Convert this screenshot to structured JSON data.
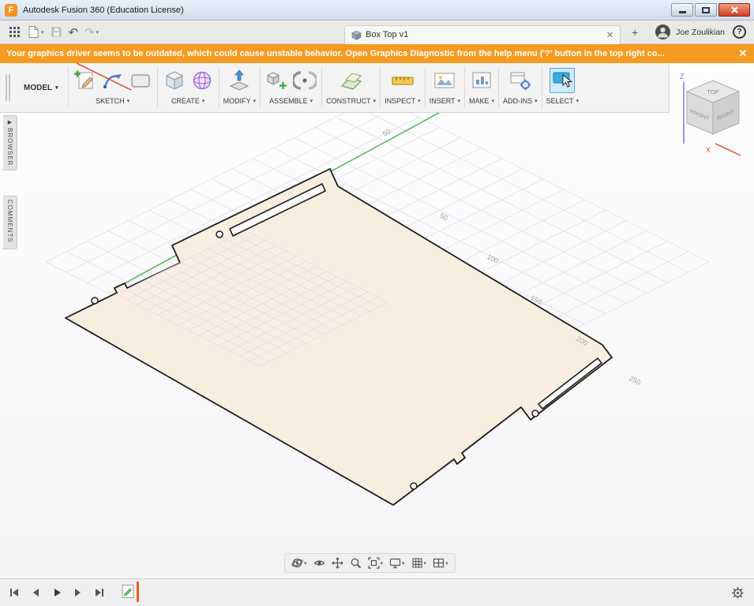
{
  "window": {
    "logo_letter": "F",
    "title": "Autodesk Fusion 360 (Education License)"
  },
  "tabrow": {
    "undo_glyph": "↶",
    "redo_glyph": "↷",
    "tab_label": "Box Top v1",
    "tab_close": "✕",
    "new_tab": "+",
    "user_name": "Joe Zoulikian",
    "help": "?"
  },
  "banner": {
    "text": "Your graphics driver seems to be outdated, which could cause unstable behavior. Open Graphics Diagnostic from the help menu ('?' button in the top right co...",
    "close": "✕"
  },
  "toolbar": {
    "workspace": "MODEL",
    "dropdown_arrow": "▾",
    "groups": [
      {
        "label": "SKETCH"
      },
      {
        "label": "CREATE"
      },
      {
        "label": "MODIFY"
      },
      {
        "label": "ASSEMBLE"
      },
      {
        "label": "CONSTRUCT"
      },
      {
        "label": "INSPECT"
      },
      {
        "label": "INSERT"
      },
      {
        "label": "MAKE"
      },
      {
        "label": "ADD-INS"
      },
      {
        "label": "SELECT"
      }
    ]
  },
  "side_tabs": {
    "browser_arrow": "▶",
    "browser": "BROWSER",
    "comments": "COMMENTS"
  },
  "viewcube": {
    "top": "TOP",
    "front": "FRONT",
    "right": "RIGHT",
    "z_axis": "Z",
    "x_axis": "X"
  },
  "canvas": {
    "x_ticks": [
      "50",
      "100",
      "150",
      "200",
      "250"
    ],
    "y_tick": "50",
    "colors": {
      "plate_fill": "#f8eee0",
      "outline": "#1c1c1c",
      "axis_green": "#4caf50",
      "axis_red": "#e8412a",
      "grid": "#e2e4e7",
      "sketch_grid": "#eed8e9"
    }
  }
}
